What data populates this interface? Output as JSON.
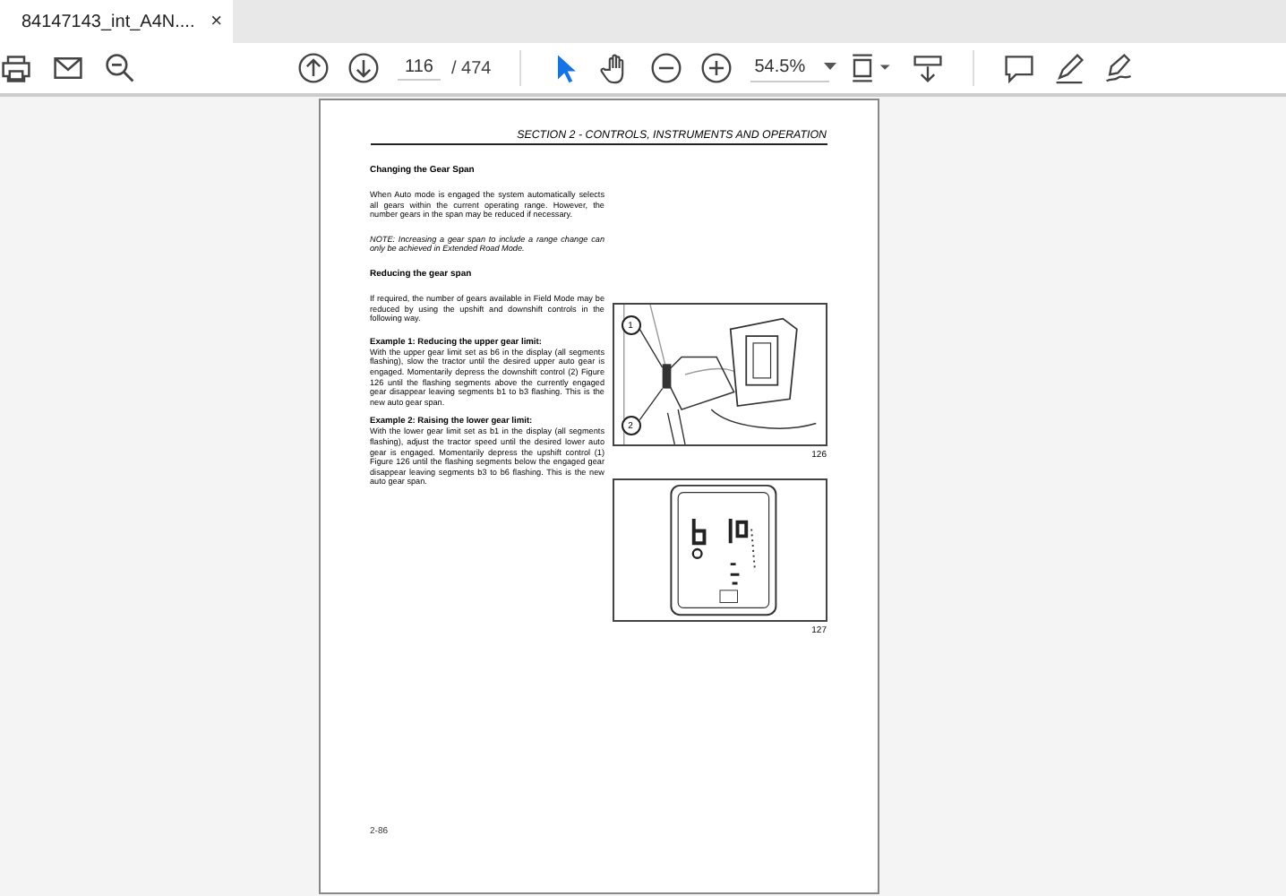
{
  "tab": {
    "title": "84147143_int_A4N....",
    "close": "×"
  },
  "toolbar": {
    "page_current": "116",
    "page_total": "/ 474",
    "zoom": "54.5%",
    "tools": [
      {
        "kind": "select",
        "selected": true
      },
      {
        "kind": "hand",
        "selected": false
      }
    ]
  },
  "page": {
    "header": "SECTION 2  - CONTROLS, INSTRUMENTS AND OPERATION",
    "blocks": [
      {
        "kind": "heading",
        "text": "Changing the Gear Span"
      },
      {
        "kind": "para",
        "text": "When Auto mode is engaged the system automatically selects all gears within the current operating range. However, the number gears in the span may be reduced if necessary."
      },
      {
        "kind": "note",
        "text": "NOTE: Increasing a gear span to include a range change can only be achieved in Extended Road Mode."
      },
      {
        "kind": "heading",
        "text": "Reducing the gear span"
      },
      {
        "kind": "para",
        "text": "If required, the number of gears available in Field Mode may be reduced by using the upshift and downshift controls in the following way."
      },
      {
        "kind": "example",
        "title": "Example 1: Reducing the upper gear limit:",
        "text": "With the upper gear limit set as b6 in the display (all segments flashing), slow the tractor until the desired upper auto gear is engaged. Momentarily depress the downshift control (2) Figure 126 until the flashing segments above the currently engaged gear disappear leaving segments b1 to b3 flashing. This is the new auto gear span."
      },
      {
        "kind": "example",
        "title": "Example 2: Raising the lower gear limit:",
        "text": "With the lower gear limit set as b1 in the display (all segments flashing), adjust the tractor speed until the desired lower auto gear is engaged. Momentarily depress the upshift control (1) Figure 126 until the flashing segments below the engaged gear disappear leaving segments b3 to b6 flashing. This is the new auto gear span."
      }
    ],
    "figures": [
      {
        "kind": "controls",
        "callouts": [
          "1",
          "2"
        ],
        "number": "126"
      },
      {
        "kind": "display",
        "number": "127"
      }
    ],
    "footer": "2-86"
  }
}
